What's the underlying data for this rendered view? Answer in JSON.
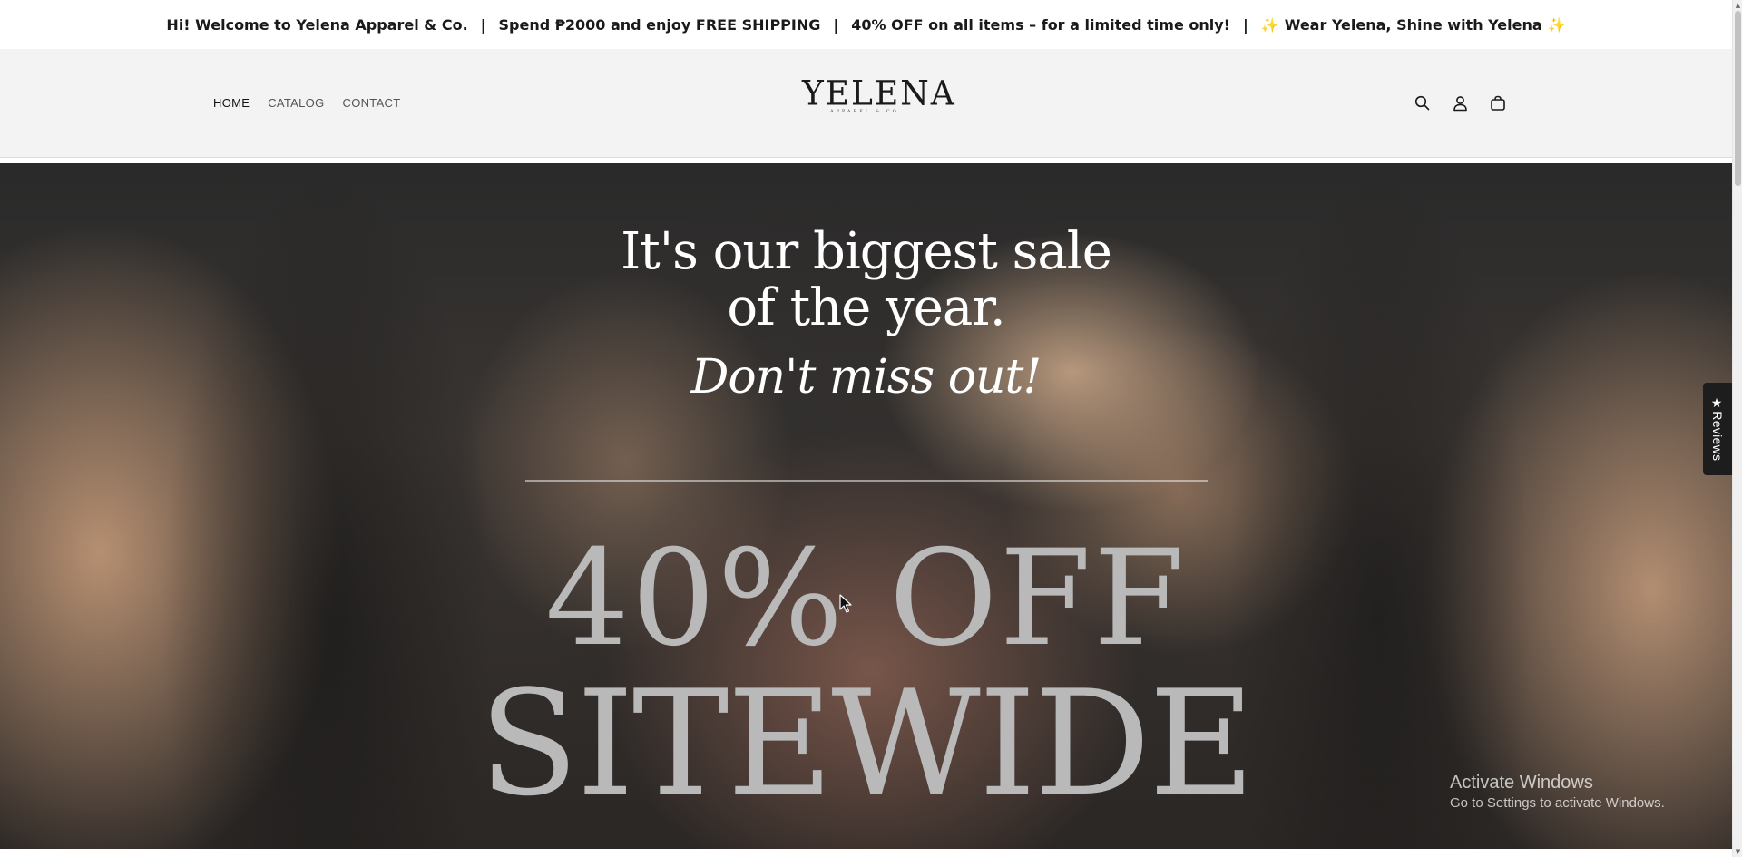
{
  "announcement": {
    "welcome": "Hi! Welcome to Yelena Apparel & Co.",
    "shipping": "Spend ₱2000 and enjoy FREE SHIPPING",
    "discount": "40% OFF on all items – for a limited time only!",
    "tagline": "Wear Yelena, Shine with Yelena",
    "separator": "|",
    "spark": "✨"
  },
  "nav": {
    "items": [
      {
        "label": "HOME"
      },
      {
        "label": "CATALOG"
      },
      {
        "label": "CONTACT"
      }
    ]
  },
  "logo": {
    "word": "YELENA",
    "sub": "APPAREL & CO."
  },
  "header_icons": [
    "search-icon",
    "account-icon",
    "cart-icon"
  ],
  "hero": {
    "line1": "It's our biggest sale",
    "line2": "of the year.",
    "italic": "Don't miss out!",
    "big1": "40% OFF",
    "big2": "SITEWIDE"
  },
  "reviews_tab": {
    "label": "★Reviews"
  },
  "watermark": {
    "title": "Activate Windows",
    "subtitle": "Go to Settings to activate Windows."
  },
  "colors": {
    "announce_text": "#1a1a1a",
    "header_bg": "#f3f3f3",
    "hero_big_text": "#b9b9b9",
    "reviews_bg": "#1d1d1d"
  }
}
